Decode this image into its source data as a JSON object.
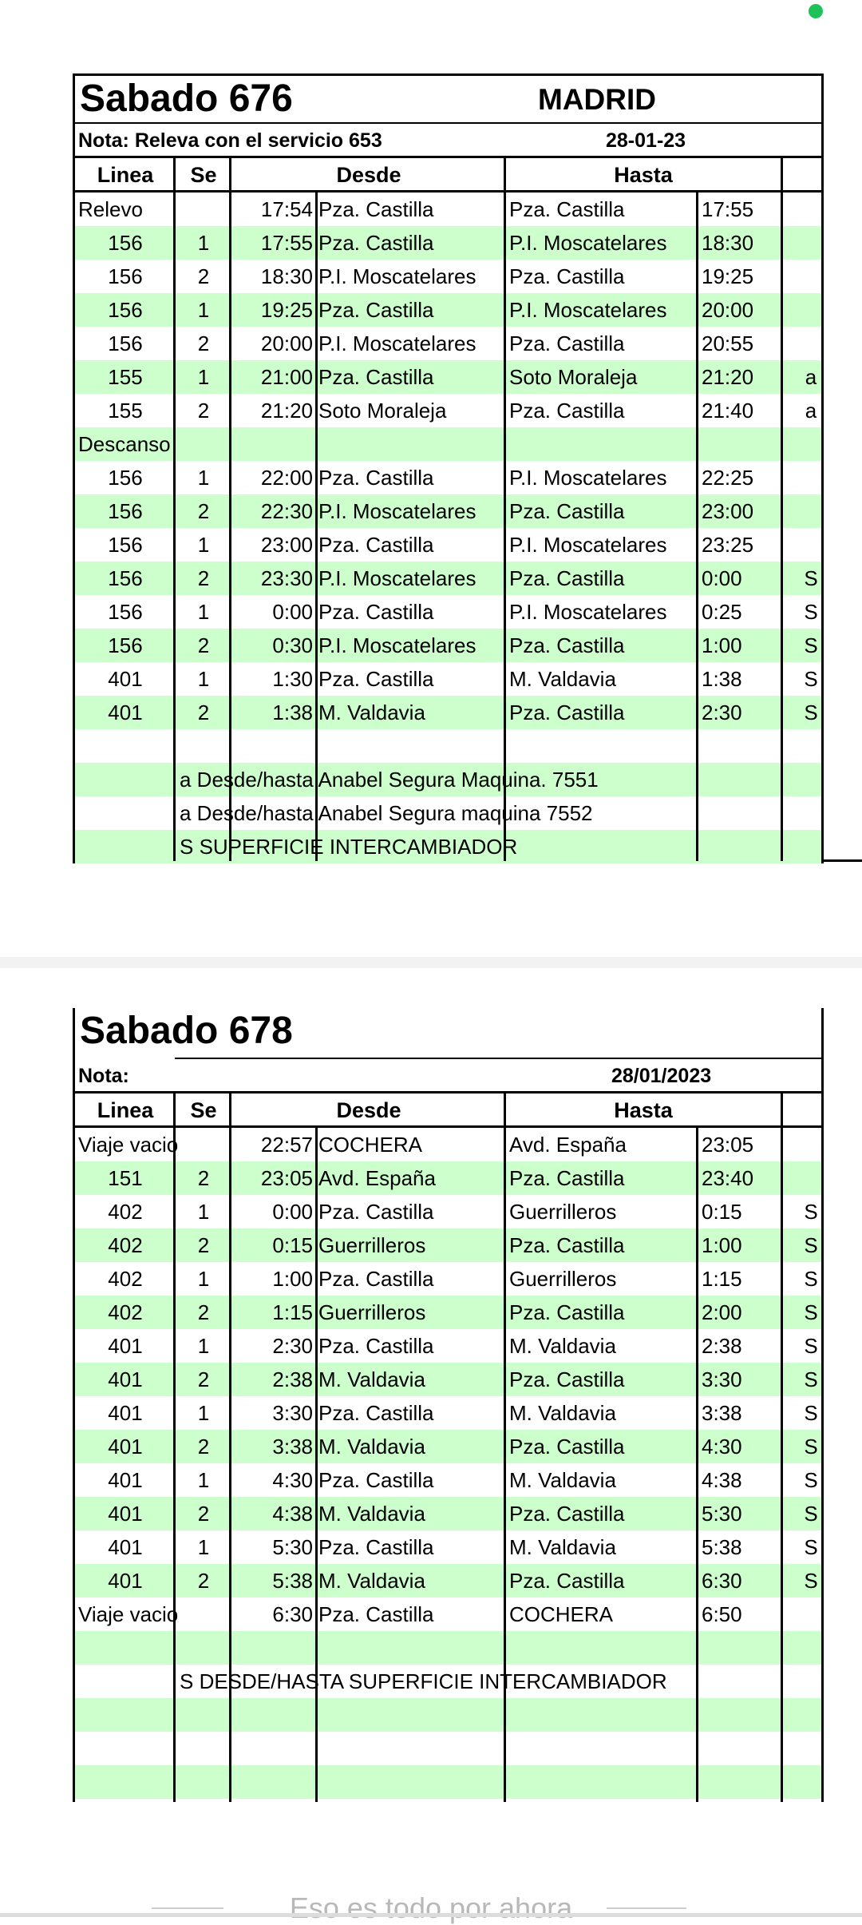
{
  "sheet1": {
    "title": "Sabado 676",
    "city": "MADRID",
    "note": "Nota: Releva con el servicio 653",
    "date": "28-01-23",
    "headers": {
      "linea": "Linea",
      "se": "Se",
      "desde": "Desde",
      "hasta": "Hasta"
    },
    "rows": [
      {
        "linea": "Relevo",
        "se": "",
        "time": "17:54",
        "desde": "Pza. Castilla",
        "hasta": "Pza. Castilla",
        "htime": "17:55",
        "flag": ""
      },
      {
        "linea": "156",
        "se": "1",
        "time": "17:55",
        "desde": "Pza. Castilla",
        "hasta": "P.I. Moscatelares",
        "htime": "18:30",
        "flag": ""
      },
      {
        "linea": "156",
        "se": "2",
        "time": "18:30",
        "desde": "P.I. Moscatelares",
        "hasta": "Pza. Castilla",
        "htime": "19:25",
        "flag": ""
      },
      {
        "linea": "156",
        "se": "1",
        "time": "19:25",
        "desde": "Pza. Castilla",
        "hasta": "P.I. Moscatelares",
        "htime": "20:00",
        "flag": ""
      },
      {
        "linea": "156",
        "se": "2",
        "time": "20:00",
        "desde": "P.I. Moscatelares",
        "hasta": "Pza. Castilla",
        "htime": "20:55",
        "flag": ""
      },
      {
        "linea": "155",
        "se": "1",
        "time": "21:00",
        "desde": "Pza. Castilla",
        "hasta": "Soto Moraleja",
        "htime": "21:20",
        "flag": "a"
      },
      {
        "linea": "155",
        "se": "2",
        "time": "21:20",
        "desde": "Soto Moraleja",
        "hasta": "Pza. Castilla",
        "htime": "21:40",
        "flag": "a"
      },
      {
        "linea": "Descanso",
        "se": "",
        "time": "",
        "desde": "",
        "hasta": "",
        "htime": "",
        "flag": ""
      },
      {
        "linea": "156",
        "se": "1",
        "time": "22:00",
        "desde": "Pza. Castilla",
        "hasta": "P.I. Moscatelares",
        "htime": "22:25",
        "flag": ""
      },
      {
        "linea": "156",
        "se": "2",
        "time": "22:30",
        "desde": "P.I. Moscatelares",
        "hasta": "Pza. Castilla",
        "htime": "23:00",
        "flag": ""
      },
      {
        "linea": "156",
        "se": "1",
        "time": "23:00",
        "desde": "Pza. Castilla",
        "hasta": "P.I. Moscatelares",
        "htime": "23:25",
        "flag": ""
      },
      {
        "linea": "156",
        "se": "2",
        "time": "23:30",
        "desde": "P.I. Moscatelares",
        "hasta": "Pza. Castilla",
        "htime": "0:00",
        "flag": "S"
      },
      {
        "linea": "156",
        "se": "1",
        "time": "0:00",
        "desde": "Pza. Castilla",
        "hasta": "P.I. Moscatelares",
        "htime": "0:25",
        "flag": "S"
      },
      {
        "linea": "156",
        "se": "2",
        "time": "0:30",
        "desde": "P.I. Moscatelares",
        "hasta": "Pza. Castilla",
        "htime": "1:00",
        "flag": "S"
      },
      {
        "linea": "401",
        "se": "1",
        "time": "1:30",
        "desde": "Pza. Castilla",
        "hasta": "M. Valdavia",
        "htime": "1:38",
        "flag": "S"
      },
      {
        "linea": "401",
        "se": "2",
        "time": "1:38",
        "desde": "M. Valdavia",
        "hasta": "Pza. Castilla",
        "htime": "2:30",
        "flag": "S"
      },
      {
        "linea": "",
        "se": "",
        "time": "",
        "desde": "",
        "hasta": "",
        "htime": "",
        "flag": ""
      }
    ],
    "footnotes": [
      "a Desde/hasta Anabel Segura Maquina. 7551",
      "a Desde/hasta Anabel Segura maquina 7552",
      "S SUPERFICIE INTERCAMBIADOR"
    ]
  },
  "sheet2": {
    "title": "Sabado 678",
    "note": "Nota:",
    "date": "28/01/2023",
    "headers": {
      "linea": "Linea",
      "se": "Se",
      "desde": "Desde",
      "hasta": "Hasta"
    },
    "rows": [
      {
        "linea": "Viaje vacio",
        "se": "",
        "time": "22:57",
        "desde": "COCHERA",
        "hasta": "Avd. España",
        "htime": "23:05",
        "flag": ""
      },
      {
        "linea": "151",
        "se": "2",
        "time": "23:05",
        "desde": "Avd. España",
        "hasta": "Pza. Castilla",
        "htime": "23:40",
        "flag": ""
      },
      {
        "linea": "402",
        "se": "1",
        "time": "0:00",
        "desde": "Pza. Castilla",
        "hasta": "Guerrilleros",
        "htime": "0:15",
        "flag": "S"
      },
      {
        "linea": "402",
        "se": "2",
        "time": "0:15",
        "desde": "Guerrilleros",
        "hasta": "Pza. Castilla",
        "htime": "1:00",
        "flag": "S"
      },
      {
        "linea": "402",
        "se": "1",
        "time": "1:00",
        "desde": "Pza. Castilla",
        "hasta": "Guerrilleros",
        "htime": "1:15",
        "flag": "S"
      },
      {
        "linea": "402",
        "se": "2",
        "time": "1:15",
        "desde": "Guerrilleros",
        "hasta": "Pza. Castilla",
        "htime": "2:00",
        "flag": "S"
      },
      {
        "linea": "401",
        "se": "1",
        "time": "2:30",
        "desde": "Pza. Castilla",
        "hasta": "M. Valdavia",
        "htime": "2:38",
        "flag": "S"
      },
      {
        "linea": "401",
        "se": "2",
        "time": "2:38",
        "desde": "M. Valdavia",
        "hasta": "Pza. Castilla",
        "htime": "3:30",
        "flag": "S"
      },
      {
        "linea": "401",
        "se": "1",
        "time": "3:30",
        "desde": "Pza. Castilla",
        "hasta": "M. Valdavia",
        "htime": "3:38",
        "flag": "S"
      },
      {
        "linea": "401",
        "se": "2",
        "time": "3:38",
        "desde": "M. Valdavia",
        "hasta": "Pza. Castilla",
        "htime": "4:30",
        "flag": "S"
      },
      {
        "linea": "401",
        "se": "1",
        "time": "4:30",
        "desde": "Pza. Castilla",
        "hasta": "M. Valdavia",
        "htime": "4:38",
        "flag": "S"
      },
      {
        "linea": "401",
        "se": "2",
        "time": "4:38",
        "desde": "M. Valdavia",
        "hasta": "Pza. Castilla",
        "htime": "5:30",
        "flag": "S"
      },
      {
        "linea": "401",
        "se": "1",
        "time": "5:30",
        "desde": "Pza. Castilla",
        "hasta": "M. Valdavia",
        "htime": "5:38",
        "flag": "S"
      },
      {
        "linea": "401",
        "se": "2",
        "time": "5:38",
        "desde": "M. Valdavia",
        "hasta": "Pza. Castilla",
        "htime": "6:30",
        "flag": "S"
      },
      {
        "linea": "Viaje vacio",
        "se": "",
        "time": "6:30",
        "desde": "Pza. Castilla",
        "hasta": "COCHERA",
        "htime": "6:50",
        "flag": ""
      },
      {
        "linea": "",
        "se": "",
        "time": "",
        "desde": "",
        "hasta": "",
        "htime": "",
        "flag": ""
      }
    ],
    "footnotes": [
      "S DESDE/HASTA SUPERFICIE INTERCAMBIADOR"
    ],
    "trailing_empty_rows": 3
  },
  "bottom_message": "Eso es todo por ahora",
  "colors": {
    "row_green": "#ccffcc",
    "status_dot": "#1fc25a"
  }
}
